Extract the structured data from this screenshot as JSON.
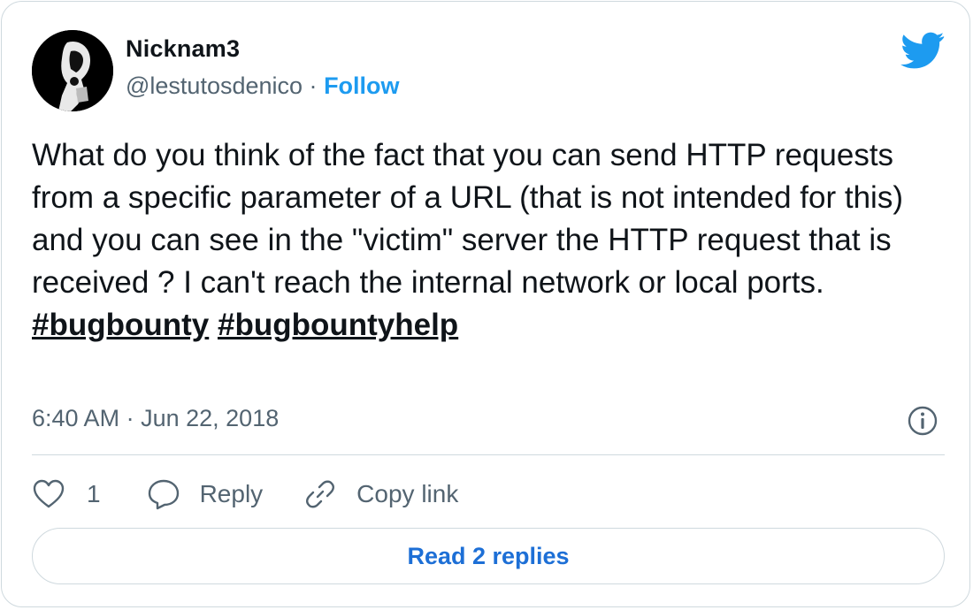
{
  "author": {
    "name": "Nicknam3",
    "handle": "@lestutosdenico",
    "separator": "·",
    "follow_label": "Follow"
  },
  "icons": {
    "avatar": "profile-avatar",
    "brand": "twitter-bird-icon",
    "info": "info-icon",
    "like": "heart-icon",
    "reply": "speech-bubble-icon",
    "copy": "link-icon"
  },
  "tweet": {
    "text": "What do you think of the fact that you can send HTTP requests from a specific parameter of a URL (that is not intended for this) and you can see in the \"victim\" server the HTTP request that is received ? I can't reach the internal network or local ports.",
    "hashtags": [
      "#bugbounty",
      "#bugbountyhelp"
    ]
  },
  "meta": {
    "time": "6:40 AM",
    "separator": "·",
    "date": "Jun 22, 2018"
  },
  "actions": {
    "like_count": "1",
    "reply_label": "Reply",
    "copy_label": "Copy link"
  },
  "replies": {
    "button_label": "Read 2 replies"
  },
  "colors": {
    "accent": "#1d9bf0",
    "secondary_text": "#536471",
    "border": "#cfd9de",
    "primary_text": "#0f1419"
  }
}
